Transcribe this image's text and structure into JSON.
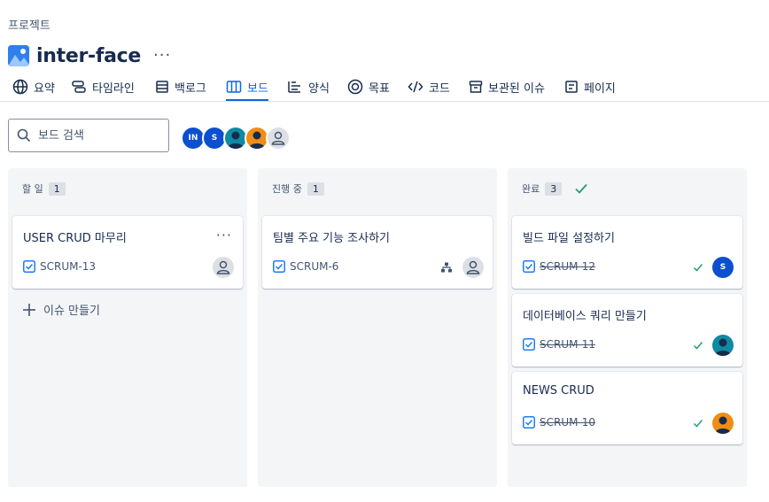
{
  "breadcrumb": "프로젝트",
  "project": {
    "title": "inter-face",
    "more": "···"
  },
  "tabs": [
    {
      "label": "요약",
      "icon": "globe-icon"
    },
    {
      "label": "타임라인",
      "icon": "timeline-icon"
    },
    {
      "label": "백로그",
      "icon": "backlog-icon"
    },
    {
      "label": "보드",
      "icon": "board-icon",
      "active": true
    },
    {
      "label": "양식",
      "icon": "form-icon"
    },
    {
      "label": "목표",
      "icon": "goal-icon"
    },
    {
      "label": "코드",
      "icon": "code-icon"
    },
    {
      "label": "보관된 이슈",
      "icon": "archive-icon"
    },
    {
      "label": "페이지",
      "icon": "page-icon"
    }
  ],
  "search": {
    "placeholder": "보드 검색"
  },
  "avatars": [
    {
      "initials": "IN",
      "color": "#0c4fcf"
    },
    {
      "initials": "S",
      "color": "#0c4fcf"
    },
    {
      "initials": "",
      "color": "#0e8aa3"
    },
    {
      "initials": "",
      "color": "#f18d13"
    },
    {
      "initials": "",
      "color": "#dcdfe4"
    }
  ],
  "columns": [
    {
      "title": "할 일",
      "count": "1",
      "cards": [
        {
          "title": "USER CRUD 마무리",
          "key": "SCRUM-13",
          "more": "···"
        }
      ],
      "create_label": "이슈 만들기"
    },
    {
      "title": "진행 중",
      "count": "1",
      "cards": [
        {
          "title": "팀별 주요 기능 조사하기",
          "key": "SCRUM-6"
        }
      ]
    },
    {
      "title": "완료",
      "count": "3",
      "cards": [
        {
          "title": "빌드 파일 설정하기",
          "key": "SCRUM-12",
          "avatar_initials": "S"
        },
        {
          "title": "데이터베이스 쿼리 만들기",
          "key": "SCRUM-11"
        },
        {
          "title": "NEWS CRUD",
          "key": "SCRUM-10"
        }
      ]
    }
  ],
  "colors": {
    "accent": "#0c66e4",
    "done_check": "#22a06b",
    "card_check": "#1d7afc"
  }
}
